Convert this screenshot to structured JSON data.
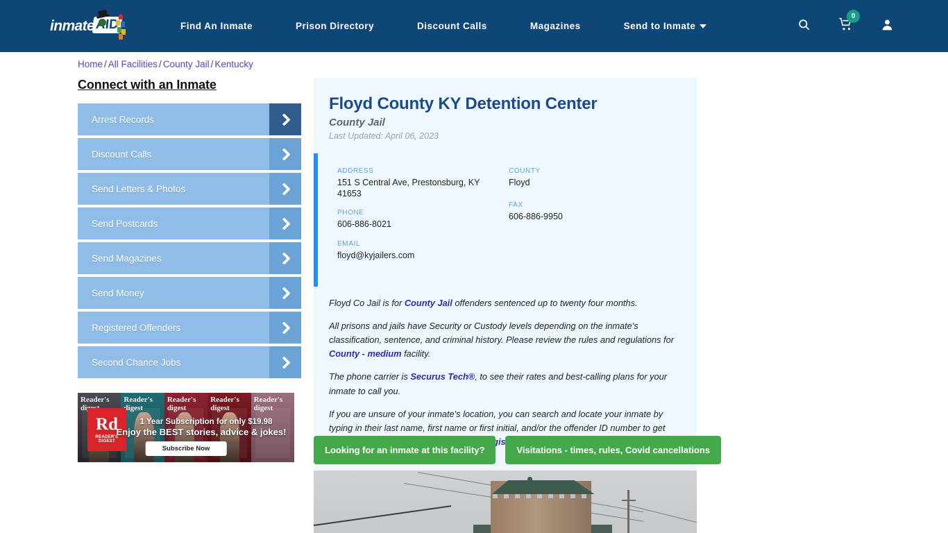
{
  "header": {
    "logo": {
      "text": "inmate",
      "badge": "AID",
      "icon": "inmate-aid-logo"
    },
    "nav": [
      {
        "label": "Find An Inmate",
        "has_caret": false
      },
      {
        "label": "Prison Directory",
        "has_caret": false
      },
      {
        "label": "Discount Calls",
        "has_caret": false
      },
      {
        "label": "Magazines",
        "has_caret": false
      },
      {
        "label": "Send to Inmate",
        "has_caret": true
      }
    ],
    "icons": {
      "search": "search-icon",
      "cart": "cart-icon",
      "cart_badge": "0",
      "account": "user-account-icon"
    },
    "background_color": "#0d4677"
  },
  "breadcrumb": {
    "items": [
      "Home",
      "All Facilities",
      "County Jail",
      "Kentucky"
    ],
    "separator": "/",
    "link_color": "#4f46c8"
  },
  "sidebar": {
    "title": "Connect with an Inmate",
    "items": [
      {
        "label": "Arrest Records",
        "active": true
      },
      {
        "label": "Discount Calls",
        "active": false
      },
      {
        "label": "Send Letters & Photos",
        "active": false
      },
      {
        "label": "Send Postcards",
        "active": false
      },
      {
        "label": "Send Magazines",
        "active": false
      },
      {
        "label": "Send Money",
        "active": false
      },
      {
        "label": "Registered Offenders",
        "active": false
      },
      {
        "label": "Second Chance Jobs",
        "active": false
      }
    ],
    "button_color": "#8fbde8",
    "arrow_box_color": "#6ba3d6",
    "active_arrow_color": "#2f5e8c"
  },
  "ad": {
    "brand": "READER'S DIGEST",
    "brand_short": "Rd",
    "magazine_titles": [
      "Reader's digest",
      "Reader's digest",
      "Reader's digest",
      "Reader's digest",
      "Reader's digest"
    ],
    "line1": "1 Year Subscription for only $19.98",
    "line2": "Enjoy the BEST stories, advice & jokes!",
    "cta": "Subscribe Now"
  },
  "facility": {
    "name": "Floyd County KY Detention Center",
    "type": "County Jail",
    "last_updated": "Last Updated: April 06, 2023",
    "panel_color": "#eff8fe",
    "accent_bar_color": "#1e90ff",
    "contact": {
      "address_label": "ADDRESS",
      "address_value": "151 S Central Ave, Prestonsburg, KY 41653",
      "county_label": "COUNTY",
      "county_value": "Floyd",
      "phone_label": "PHONE",
      "phone_value": "606-886-8021",
      "fax_label": "FAX",
      "fax_value": "606-886-9950",
      "email_label": "EMAIL",
      "email_value": "floyd@kyjailers.com"
    },
    "paragraphs": [
      {
        "parts": [
          {
            "text": "Floyd Co Jail is for ",
            "link": false
          },
          {
            "text": "County Jail",
            "link": true
          },
          {
            "text": " offenders sentenced up to twenty four months.",
            "link": false
          }
        ]
      },
      {
        "parts": [
          {
            "text": "All prisons and jails have Security or Custody levels depending on the inmate's classification, sentence, and criminal history. Please review the rules and regulations for ",
            "link": false
          },
          {
            "text": "County - medium",
            "link": true
          },
          {
            "text": " facility.",
            "link": false
          }
        ]
      },
      {
        "parts": [
          {
            "text": "The phone carrier is ",
            "link": false
          },
          {
            "text": "Securus Tech®",
            "link": true
          },
          {
            "text": ", to see their rates and best-calling plans for your inmate to call you.",
            "link": false
          }
        ]
      },
      {
        "parts": [
          {
            "text": "If you are unsure of your inmate's location, you can search and locate your inmate by typing in their last name, first name or first initial, and/or the offender ID number to get their accurate information immediately ",
            "link": false
          },
          {
            "text": "Registered Offenders",
            "link": true
          }
        ]
      }
    ],
    "actions": [
      {
        "label": "Looking for an inmate at this facility?"
      },
      {
        "label": "Visitations - times, rules, Covid cancellations"
      }
    ],
    "action_color": "#44a94a",
    "photo_alt": "facility-exterior-photo"
  }
}
